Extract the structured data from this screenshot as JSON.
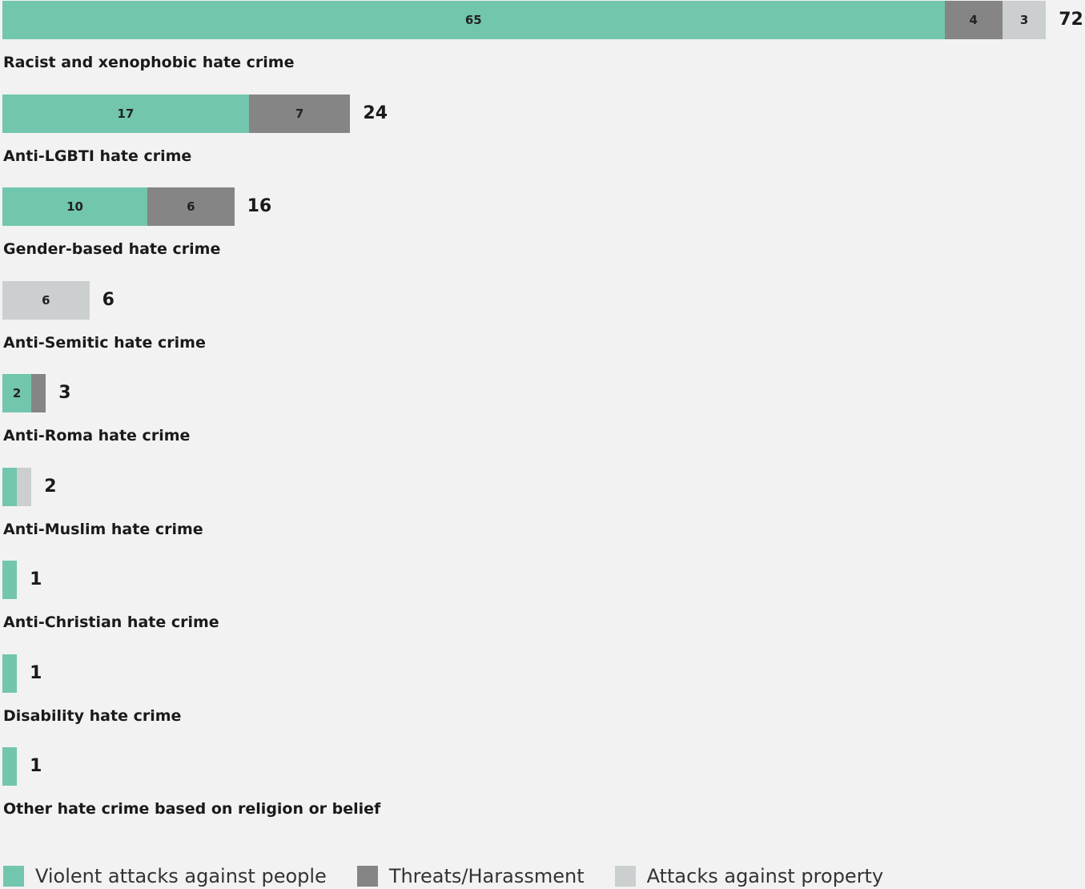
{
  "chart_data": {
    "type": "bar",
    "orientation": "horizontal",
    "stacked": true,
    "categories": [
      "Racist and xenophobic hate crime",
      "Anti-LGBTI hate crime",
      "Gender-based hate crime",
      "Anti-Semitic hate crime",
      "Anti-Roma hate crime",
      "Anti-Muslim hate crime",
      "Anti-Christian hate crime",
      "Disability hate crime",
      "Other hate crime based on religion or belief"
    ],
    "series": [
      {
        "name": "Violent attacks against people",
        "color": "#72c6ae",
        "values": [
          65,
          17,
          10,
          0,
          2,
          1,
          1,
          1,
          1
        ]
      },
      {
        "name": "Threats/Harassment",
        "color": "#858585",
        "values": [
          4,
          7,
          6,
          0,
          1,
          0,
          0,
          0,
          0
        ]
      },
      {
        "name": "Attacks against property",
        "color": "#cbcfcf",
        "values": [
          3,
          0,
          0,
          6,
          0,
          1,
          0,
          0,
          0
        ]
      }
    ],
    "totals": [
      72,
      24,
      16,
      6,
      3,
      2,
      1,
      1,
      1
    ],
    "segment_labels_shown": [
      [
        true,
        true,
        true
      ],
      [
        true,
        true,
        false
      ],
      [
        true,
        true,
        false
      ],
      [
        false,
        false,
        true
      ],
      [
        true,
        false,
        false
      ],
      [
        false,
        false,
        false
      ],
      [
        false,
        false,
        false
      ],
      [
        false,
        false,
        false
      ],
      [
        false,
        false,
        false
      ]
    ],
    "legend_position": "bottom-left",
    "grid": false,
    "title": "",
    "xlabel": "",
    "ylabel": ""
  }
}
